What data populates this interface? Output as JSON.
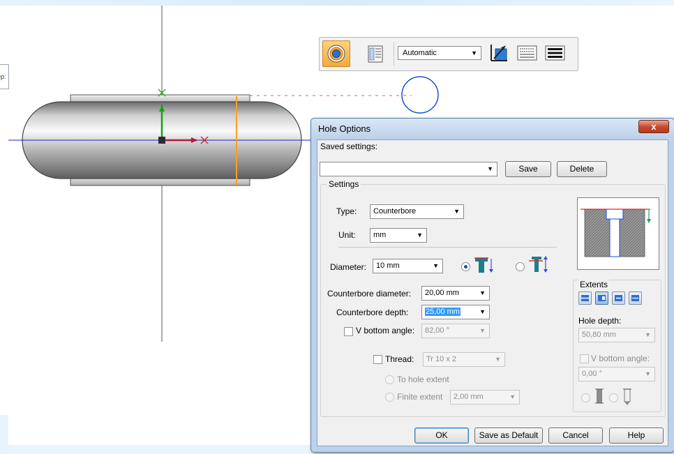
{
  "toolbar": {
    "mode_value": "Automatic",
    "icons": [
      "hole-shape-icon",
      "hole-options-icon",
      "extent-step-icon",
      "profile-icon",
      "line-weight-icon"
    ]
  },
  "canvas": {
    "tab_stub_text": "ep:"
  },
  "dialog": {
    "title": "Hole Options",
    "close_label": "x",
    "saved_settings_label": "Saved settings:",
    "saved_settings_value": "",
    "save_label": "Save",
    "delete_label": "Delete",
    "settings_group_label": "Settings",
    "type_label": "Type:",
    "type_value": "Counterbore",
    "unit_label": "Unit:",
    "unit_value": "mm",
    "diameter_label": "Diameter:",
    "diameter_value": "10 mm",
    "counterbore_diameter_label": "Counterbore diameter:",
    "counterbore_diameter_value": "20,00 mm",
    "counterbore_depth_label": "Counterbore depth:",
    "counterbore_depth_value": "25,00 mm",
    "v_bottom_angle_label": "V bottom angle:",
    "v_bottom_angle_value": "82,00 °",
    "thread_label": "Thread:",
    "thread_value": "Tr 10 x 2",
    "to_hole_extent_label": "To hole extent",
    "finite_extent_label": "Finite extent",
    "finite_extent_value": "2,00 mm",
    "extents_label": "Extents",
    "hole_depth_label": "Hole depth:",
    "hole_depth_value": "50,80 mm",
    "extent_v_bottom_angle_label": "V bottom angle:",
    "extent_v_bottom_angle_value": "0,00 °",
    "ok_label": "OK",
    "save_as_default_label": "Save as Default",
    "cancel_label": "Cancel",
    "help_label": "Help"
  },
  "colors": {
    "accent_orange": "#f2a93a",
    "axis_blue": "#1a1ad6",
    "counterbore_red": "#d62b2b",
    "selection_blue": "#3399ff"
  }
}
